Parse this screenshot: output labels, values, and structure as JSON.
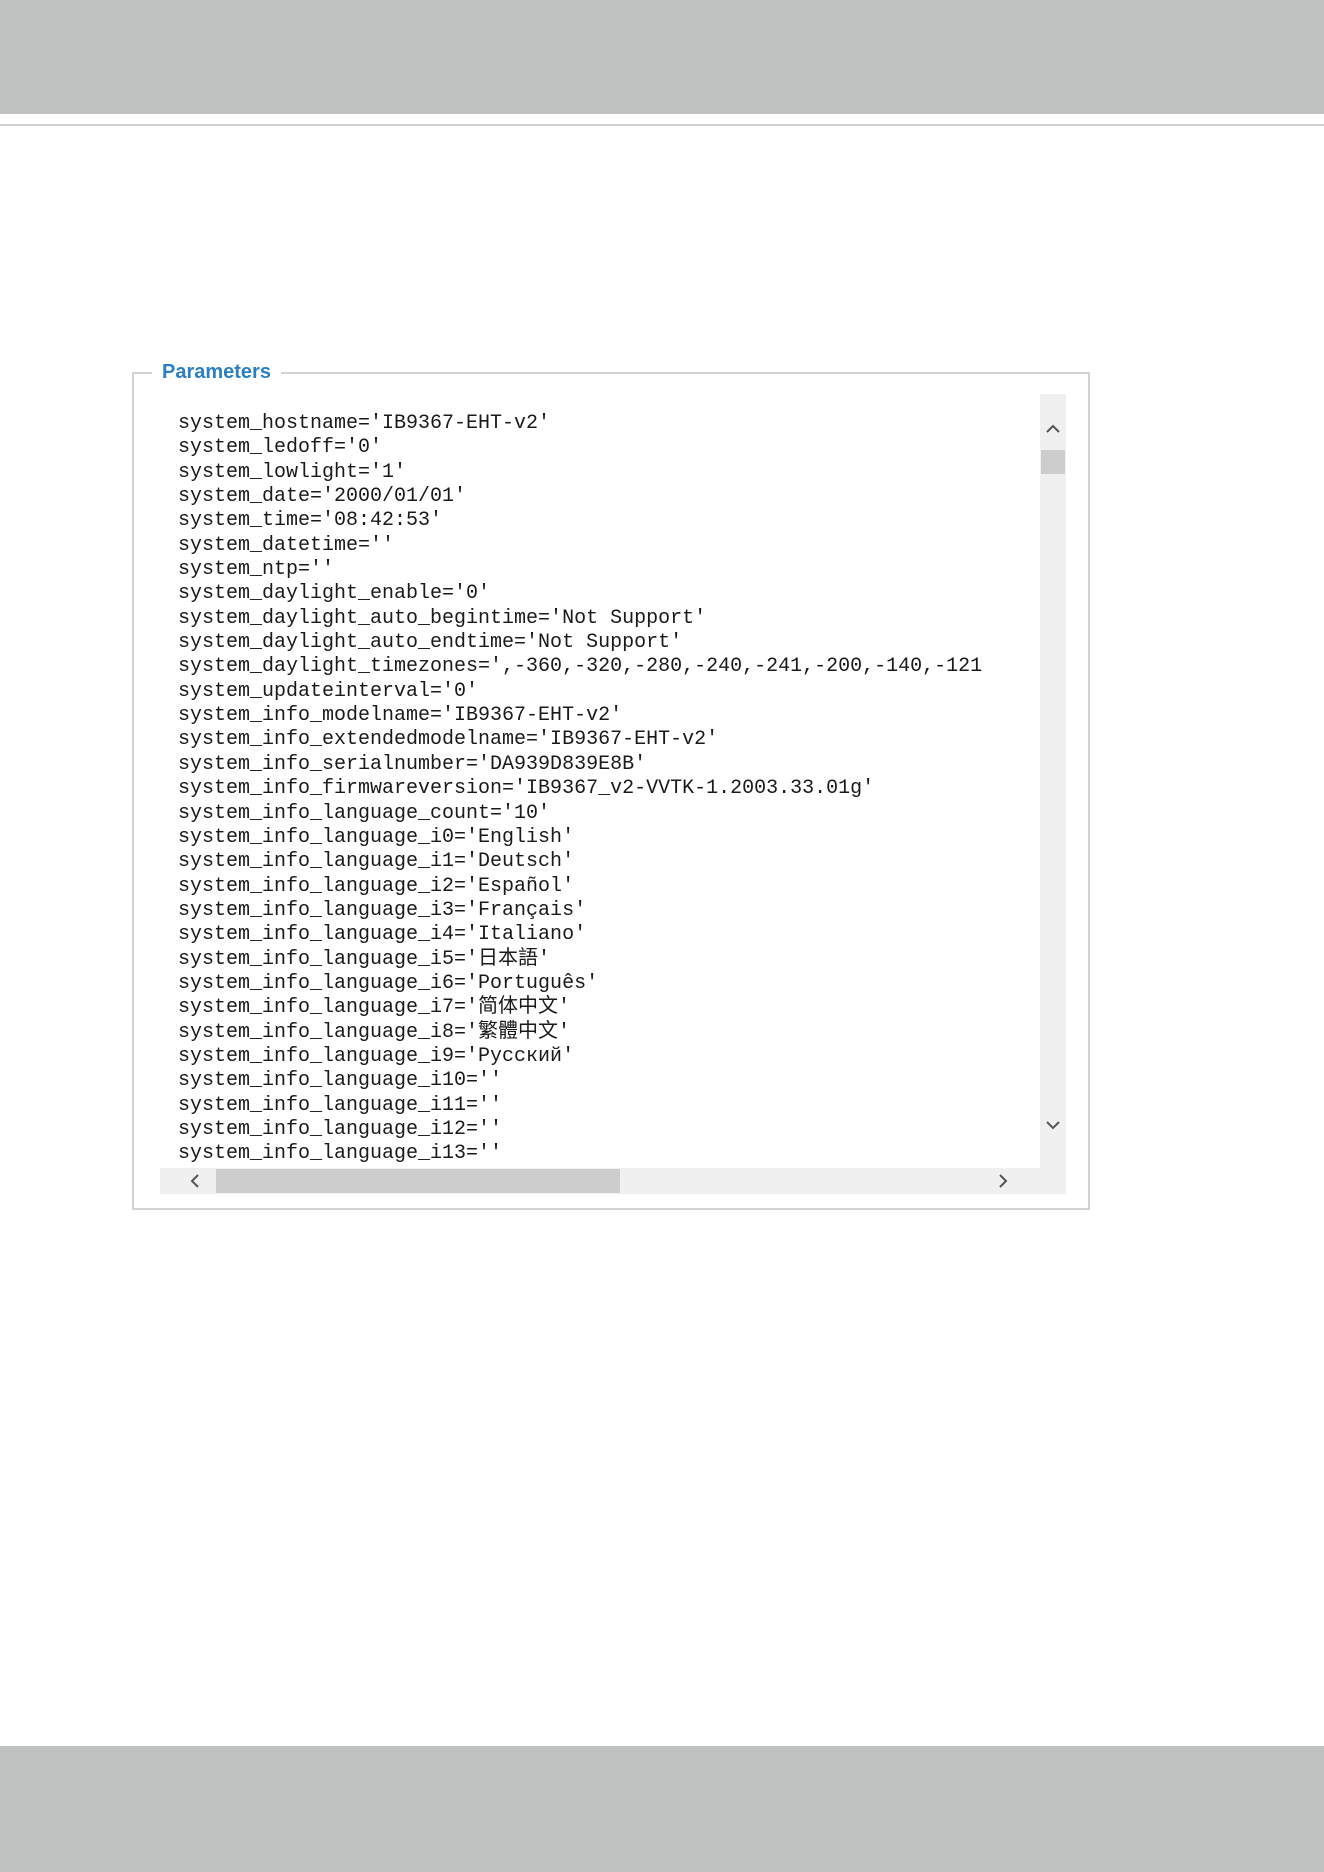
{
  "panel": {
    "legend": "Parameters",
    "lines": [
      "system_hostname='IB9367-EHT-v2'",
      "system_ledoff='0'",
      "system_lowlight='1'",
      "system_date='2000/01/01'",
      "system_time='08:42:53'",
      "system_datetime=''",
      "system_ntp=''",
      "system_daylight_enable='0'",
      "system_daylight_auto_begintime='Not Support'",
      "system_daylight_auto_endtime='Not Support'",
      "system_daylight_timezones=',-360,-320,-280,-240,-241,-200,-140,-121",
      "system_updateinterval='0'",
      "system_info_modelname='IB9367-EHT-v2'",
      "system_info_extendedmodelname='IB9367-EHT-v2'",
      "system_info_serialnumber='DA939D839E8B'",
      "system_info_firmwareversion='IB9367_v2-VVTK-1.2003.33.01g'",
      "system_info_language_count='10'",
      "system_info_language_i0='English'",
      "system_info_language_i1='Deutsch'",
      "system_info_language_i2='Español'",
      "system_info_language_i3='Français'",
      "system_info_language_i4='Italiano'",
      "system_info_language_i5='日本語'",
      "system_info_language_i6='Português'",
      "system_info_language_i7='简体中文'",
      "system_info_language_i8='繁體中文'",
      "system_info_language_i9='Русский'",
      "system_info_language_i10=''",
      "system_info_language_i11=''",
      "system_info_language_i12=''",
      "system_info_language_i13=''"
    ]
  },
  "icons": {
    "scroll_up": "chevron-up-icon",
    "scroll_down": "chevron-down-icon",
    "scroll_left": "chevron-left-icon",
    "scroll_right": "chevron-right-icon"
  },
  "colors": {
    "legend": "#2b7fc5",
    "band": "#c0c2c2"
  }
}
